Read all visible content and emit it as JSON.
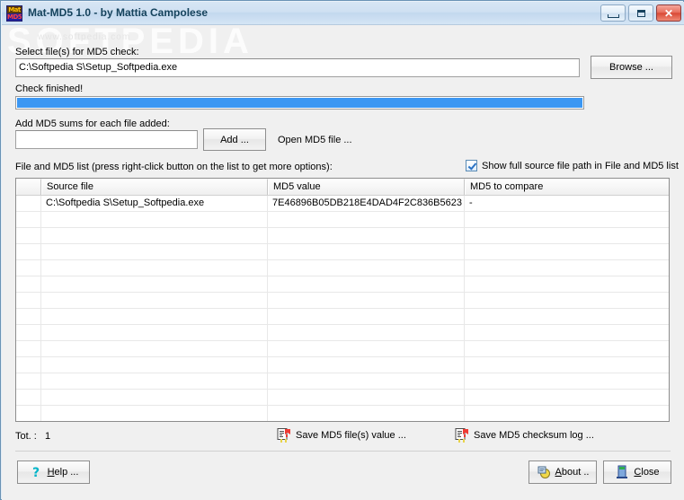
{
  "window": {
    "title": "Mat-MD5 1.0 - by Mattia Campolese",
    "icon": "app-icon-matmd5",
    "icon_top_text": "Mat",
    "icon_bottom_text": "MD5",
    "controls": {
      "minimize": "minimize-icon",
      "maximize": "maximize-icon",
      "close": "close-icon"
    }
  },
  "watermark": {
    "text": "SOFTPEDIA",
    "subtext": "www.softpedia.com"
  },
  "select_file": {
    "label": "Select file(s) for MD5 check:",
    "value": "C:\\Softpedia S\\Setup_Softpedia.exe",
    "placeholder": "",
    "browse_label": "Browse ..."
  },
  "progress": {
    "status": "Check finished!",
    "percent": 100
  },
  "add_sums": {
    "label": "Add MD5 sums for each file added:",
    "value": "",
    "placeholder": "",
    "add_label": "Add ...",
    "open_md5_label": "Open MD5 file ..."
  },
  "list_section": {
    "label": "File and MD5 list (press right-click button on the list to get more options):",
    "show_full_path": {
      "label": "Show full source file path in File and MD5 list",
      "checked": true
    },
    "columns": [
      "",
      "Source file",
      "MD5 value",
      "MD5 to compare"
    ],
    "rows": [
      [
        "",
        "C:\\Softpedia S\\Setup_Softpedia.exe",
        "7E46896B05DB218E4DAD4F2C836B5623",
        "-"
      ]
    ],
    "empty_row_count": 13
  },
  "status": {
    "total_label": "Tot. :",
    "total_value": "1"
  },
  "commands": {
    "save_md5_files_value": "Save MD5 file(s) value ...",
    "save_md5_checksum_log": "Save MD5 checksum log ...",
    "save_icon": "save-document-icon"
  },
  "footer": {
    "help": {
      "label": "Help ...",
      "icon": "question-mark-icon"
    },
    "about": {
      "label": "About ..",
      "icon": "about-info-icon"
    },
    "close": {
      "label": "Close",
      "icon": "exit-door-icon"
    }
  },
  "colors": {
    "progress_fill": "#3b97f3",
    "title_text": "#14425c",
    "close_button": "#d94a36"
  }
}
